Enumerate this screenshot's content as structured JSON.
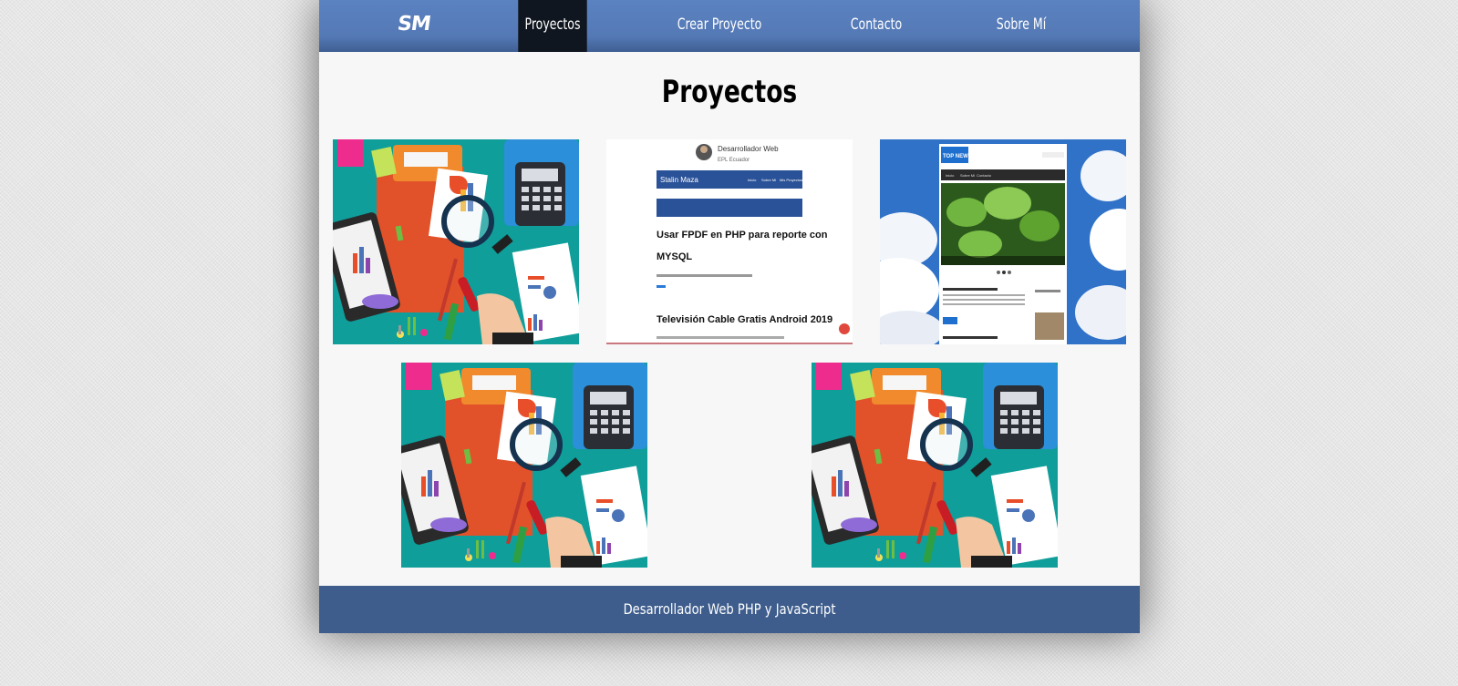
{
  "nav": {
    "logo": "SM",
    "items": [
      {
        "label": "Proyectos",
        "active": true
      },
      {
        "label": "Crear Proyecto",
        "active": false
      },
      {
        "label": "Contacto",
        "active": false
      },
      {
        "label": "Sobre Mí",
        "active": false
      }
    ]
  },
  "main": {
    "title": "Proyectos"
  },
  "thumb2": {
    "profile_name": "Desarrollador Web",
    "profile_location": "EPL Ecuador",
    "brand": "Stalin Maza",
    "nav_links": [
      "Inicio",
      "Sobre Mi",
      "Mis Proyectos"
    ],
    "post1_title_line1": "Usar FPDF en PHP para reporte con",
    "post1_title_line2": "MYSQL",
    "post2_title": "Televisión Cable Gratis Android 2019"
  },
  "thumb3": {
    "logo": "TOP NEWS",
    "nav_links": [
      "Inicio",
      "Sobre Mi",
      "Contacto"
    ]
  },
  "footer": {
    "text": "Desarrollador Web PHP y JavaScript"
  },
  "colors": {
    "nav": "#5479b5",
    "nav_active": "#10161f",
    "footer": "#3e5d8c",
    "content_bg": "#f7f7f7",
    "teal": "#0f9e9a"
  }
}
